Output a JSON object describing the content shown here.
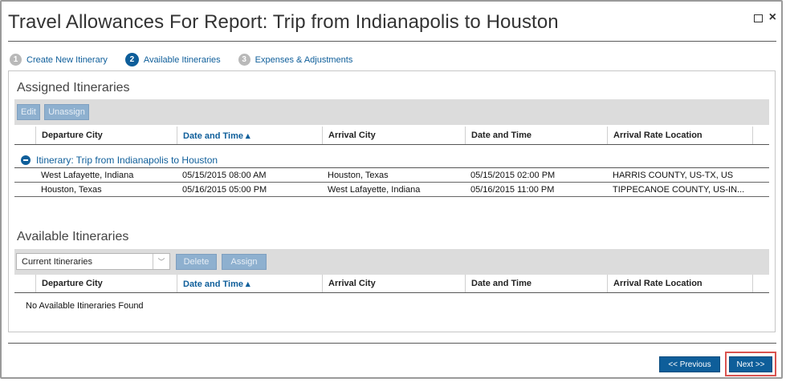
{
  "dialog": {
    "title": "Travel Allowances For Report: Trip from Indianapolis to Houston",
    "close_symbol": "×"
  },
  "steps": [
    {
      "num": "1",
      "label": "Create New Itinerary",
      "active": false
    },
    {
      "num": "2",
      "label": "Available Itineraries",
      "active": true
    },
    {
      "num": "3",
      "label": "Expenses & Adjustments",
      "active": false
    }
  ],
  "assigned": {
    "title": "Assigned Itineraries",
    "edit_label": "Edit",
    "unassign_label": "Unassign",
    "columns": [
      "Departure City",
      "Date and Time ▴",
      "Arrival City",
      "Date and Time",
      "Arrival Rate Location"
    ],
    "group_label": "Itinerary: Trip from Indianapolis to Houston",
    "rows": [
      [
        "West Lafayette, Indiana",
        "05/15/2015 08:00 AM",
        "Houston, Texas",
        "05/15/2015 02:00 PM",
        "HARRIS COUNTY, US-TX, US"
      ],
      [
        "Houston, Texas",
        "05/16/2015 05:00 PM",
        "West Lafayette, Indiana",
        "05/16/2015 11:00 PM",
        "TIPPECANOE COUNTY, US-IN..."
      ]
    ]
  },
  "available": {
    "title": "Available Itineraries",
    "filter_value": "Current Itineraries",
    "delete_label": "Delete",
    "assign_label": "Assign",
    "columns": [
      "Departure City",
      "Date and Time ▴",
      "Arrival City",
      "Date and Time",
      "Arrival Rate Location"
    ],
    "empty_message": "No Available Itineraries Found"
  },
  "footer": {
    "previous_label": "<< Previous",
    "next_label": "Next >>"
  },
  "colors": {
    "accent": "#0e5e9a",
    "highlight": "#d9534f"
  }
}
